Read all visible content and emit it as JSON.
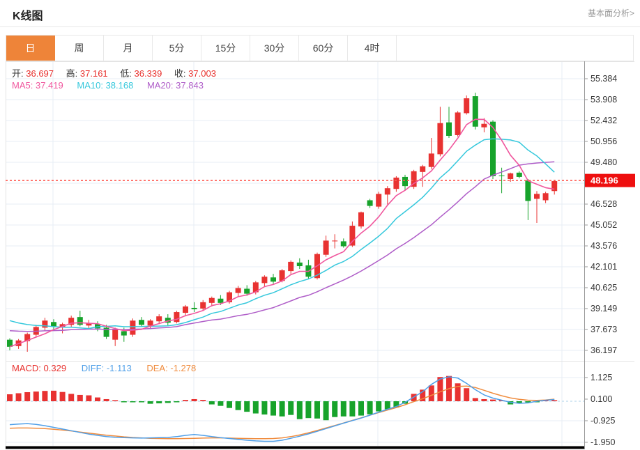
{
  "page": {
    "title": "K线图",
    "top_link": "基本面分析>"
  },
  "tabs": [
    {
      "label": "日",
      "active": true
    },
    {
      "label": "周",
      "active": false
    },
    {
      "label": "月",
      "active": false
    },
    {
      "label": "5分",
      "active": false
    },
    {
      "label": "15分",
      "active": false
    },
    {
      "label": "30分",
      "active": false
    },
    {
      "label": "60分",
      "active": false
    },
    {
      "label": "4时",
      "active": false
    }
  ],
  "legend": {
    "open_label": "开:",
    "open": "36.697",
    "high_label": "高:",
    "high": "37.161",
    "low_label": "低:",
    "low": "36.339",
    "close_label": "收:",
    "close": "37.003",
    "ma5_label": "MA5:",
    "ma5": "37.419",
    "ma10_label": "MA10:",
    "ma10": "38.168",
    "ma20_label": "MA20:",
    "ma20": "37.843"
  },
  "macd_legend": {
    "macd_label": "MACD:",
    "macd": "0.329",
    "diff_label": "DIFF:",
    "diff": "-1.113",
    "dea_label": "DEA:",
    "dea": "-1.278"
  },
  "current_price_label": "48.196",
  "colors": {
    "accent_orange": "#ee8439",
    "up_red": "#e83231",
    "down_green": "#17a32b",
    "ma5_pink": "#f0569d",
    "ma10_cyan": "#35c8dc",
    "ma20_purple": "#af5dc8",
    "diff_blue": "#4f9fe8",
    "dea_orange": "#f08c3e",
    "price_flag_red": "#ee0f0f",
    "dashed_line_red": "#ff5a52",
    "zero_dash_blue": "#c7e0f0",
    "grid": "#e7eef4",
    "axis_line": "#999999",
    "frame": "#e3e3e3",
    "axis_text": "#333333",
    "bottom_bar": "#000000"
  },
  "chart_data": {
    "type": "candlestick",
    "title": "K线图 (daily K-line with MA5/MA10/MA20 and MACD)",
    "price_axis_ticks": [
      55.384,
      53.908,
      52.432,
      50.956,
      49.48,
      46.528,
      45.052,
      43.576,
      42.101,
      40.625,
      39.149,
      37.673,
      36.197
    ],
    "hidden_gridline_value": 48.004,
    "macd_axis_ticks": [
      1.125,
      0.1,
      -0.925,
      -1.95
    ],
    "current_price": 48.196,
    "ylim": [
      35.46,
      56.6
    ],
    "macd_ylim": [
      -2.2,
      1.4
    ],
    "grid": true,
    "vertical_gridlines_x": [
      76,
      278,
      542,
      806
    ],
    "candles_ohlc": [
      [
        36.95,
        37.05,
        36.2,
        36.45
      ],
      [
        36.5,
        37.0,
        36.3,
        36.9
      ],
      [
        36.85,
        37.45,
        36.1,
        37.35
      ],
      [
        37.3,
        38.0,
        37.1,
        37.85
      ],
      [
        37.8,
        38.5,
        37.55,
        38.3
      ],
      [
        38.2,
        38.4,
        37.6,
        37.9
      ],
      [
        37.85,
        38.15,
        37.4,
        38.05
      ],
      [
        38.0,
        38.65,
        37.85,
        38.5
      ],
      [
        38.55,
        39.0,
        37.9,
        38.0
      ],
      [
        37.95,
        38.35,
        37.7,
        38.1
      ],
      [
        38.05,
        38.25,
        37.55,
        37.75
      ],
      [
        37.8,
        38.0,
        37.0,
        37.15
      ],
      [
        36.95,
        37.8,
        36.5,
        37.7
      ],
      [
        37.55,
        37.8,
        36.8,
        37.25
      ],
      [
        37.3,
        38.45,
        37.15,
        38.3
      ],
      [
        38.35,
        38.55,
        37.85,
        38.0
      ],
      [
        37.95,
        38.4,
        37.7,
        38.3
      ],
      [
        38.25,
        38.75,
        38.05,
        38.6
      ],
      [
        38.5,
        38.75,
        37.95,
        38.15
      ],
      [
        38.2,
        39.0,
        38.1,
        38.9
      ],
      [
        38.85,
        39.4,
        38.6,
        39.3
      ],
      [
        39.2,
        39.6,
        38.9,
        39.1
      ],
      [
        39.15,
        39.75,
        39.0,
        39.6
      ],
      [
        39.55,
        40.0,
        39.3,
        39.9
      ],
      [
        39.85,
        40.1,
        39.4,
        39.55
      ],
      [
        39.6,
        40.4,
        39.5,
        40.3
      ],
      [
        40.25,
        40.75,
        40.0,
        40.6
      ],
      [
        40.55,
        40.8,
        40.05,
        40.2
      ],
      [
        40.3,
        41.1,
        40.15,
        41.0
      ],
      [
        40.95,
        41.5,
        40.7,
        41.4
      ],
      [
        41.35,
        41.6,
        40.9,
        41.05
      ],
      [
        41.1,
        41.95,
        41.0,
        41.85
      ],
      [
        41.8,
        42.55,
        41.6,
        42.45
      ],
      [
        42.4,
        42.7,
        41.95,
        42.15
      ],
      [
        42.2,
        42.6,
        41.25,
        41.4
      ],
      [
        41.3,
        43.1,
        41.2,
        43.0
      ],
      [
        42.95,
        44.3,
        42.8,
        43.95
      ],
      [
        43.9,
        44.4,
        43.4,
        43.95
      ],
      [
        43.9,
        44.1,
        43.45,
        43.55
      ],
      [
        43.6,
        45.3,
        43.5,
        45.0
      ],
      [
        44.95,
        46.0,
        44.8,
        45.95
      ],
      [
        46.8,
        46.9,
        46.25,
        46.4
      ],
      [
        46.35,
        47.4,
        46.2,
        47.25
      ],
      [
        47.2,
        47.8,
        46.5,
        47.65
      ],
      [
        47.6,
        48.5,
        47.4,
        48.4
      ],
      [
        48.45,
        48.6,
        47.5,
        47.8
      ],
      [
        47.75,
        48.95,
        47.6,
        48.85
      ],
      [
        48.8,
        49.3,
        47.75,
        49.2
      ],
      [
        49.15,
        51.2,
        49.0,
        50.1
      ],
      [
        50.05,
        53.4,
        49.9,
        52.25
      ],
      [
        52.3,
        53.4,
        51.2,
        51.35
      ],
      [
        51.4,
        53.1,
        51.3,
        53.0
      ],
      [
        52.95,
        54.2,
        52.85,
        54.0
      ],
      [
        54.15,
        54.4,
        51.8,
        52.0
      ],
      [
        51.95,
        52.6,
        51.6,
        52.2
      ],
      [
        52.35,
        52.45,
        48.3,
        48.5
      ],
      [
        48.55,
        49.1,
        47.3,
        48.5
      ],
      [
        48.3,
        48.75,
        48.1,
        48.7
      ],
      [
        48.75,
        48.85,
        48.35,
        48.45
      ],
      [
        48.2,
        48.3,
        45.4,
        46.75
      ],
      [
        46.9,
        47.45,
        45.2,
        47.25
      ],
      [
        46.8,
        47.4,
        46.6,
        47.3
      ],
      [
        47.45,
        48.25,
        47.2,
        48.15
      ]
    ],
    "ma_periods": {
      "ma5": 5,
      "ma10": 10,
      "ma20": 20
    },
    "ma_seeds": {
      "ma5": null,
      "ma10": 38.5,
      "ma20": 37.65
    },
    "macd_histogram": [
      0.33,
      0.38,
      0.43,
      0.46,
      0.49,
      0.5,
      0.44,
      0.35,
      0.3,
      0.28,
      0.18,
      0.1,
      0.04,
      -0.04,
      -0.03,
      -0.02,
      -0.12,
      -0.1,
      -0.08,
      -0.05,
      0.06,
      0.1,
      0.06,
      -0.15,
      -0.22,
      -0.32,
      -0.42,
      -0.5,
      -0.58,
      -0.63,
      -0.68,
      -0.72,
      -0.65,
      -0.85,
      -0.8,
      -0.82,
      -0.9,
      -0.75,
      -0.72,
      -0.72,
      -0.68,
      -0.62,
      -0.48,
      -0.38,
      -0.3,
      -0.12,
      0.35,
      0.55,
      0.75,
      1.15,
      1.2,
      0.85,
      0.62,
      0.15,
      0.1,
      0.08,
      0.03,
      -0.15,
      -0.1,
      -0.06,
      -0.03,
      0.03,
      0.05
    ],
    "diff_line": [
      -1.11,
      -1.08,
      -1.06,
      -1.1,
      -1.16,
      -1.24,
      -1.32,
      -1.4,
      -1.48,
      -1.56,
      -1.62,
      -1.68,
      -1.71,
      -1.73,
      -1.74,
      -1.75,
      -1.74,
      -1.73,
      -1.72,
      -1.68,
      -1.62,
      -1.58,
      -1.62,
      -1.68,
      -1.73,
      -1.77,
      -1.81,
      -1.85,
      -1.88,
      -1.9,
      -1.9,
      -1.85,
      -1.76,
      -1.66,
      -1.55,
      -1.43,
      -1.3,
      -1.17,
      -1.04,
      -0.92,
      -0.8,
      -0.66,
      -0.52,
      -0.38,
      -0.25,
      -0.05,
      0.2,
      0.45,
      0.8,
      1.05,
      1.16,
      1.1,
      0.85,
      0.55,
      0.3,
      0.15,
      0.05,
      -0.05,
      -0.1,
      -0.08,
      0.0,
      0.05,
      0.08
    ],
    "dea_line": [
      -1.28,
      -1.27,
      -1.27,
      -1.28,
      -1.3,
      -1.33,
      -1.37,
      -1.41,
      -1.46,
      -1.51,
      -1.56,
      -1.61,
      -1.65,
      -1.69,
      -1.72,
      -1.74,
      -1.76,
      -1.77,
      -1.78,
      -1.78,
      -1.77,
      -1.76,
      -1.75,
      -1.74,
      -1.74,
      -1.75,
      -1.76,
      -1.77,
      -1.78,
      -1.78,
      -1.77,
      -1.74,
      -1.68,
      -1.6,
      -1.5,
      -1.39,
      -1.27,
      -1.15,
      -1.03,
      -0.91,
      -0.79,
      -0.66,
      -0.54,
      -0.42,
      -0.3,
      -0.17,
      -0.02,
      0.12,
      0.28,
      0.45,
      0.6,
      0.7,
      0.72,
      0.65,
      0.52,
      0.38,
      0.26,
      0.16,
      0.09,
      0.05,
      0.04,
      0.06,
      0.1
    ]
  }
}
